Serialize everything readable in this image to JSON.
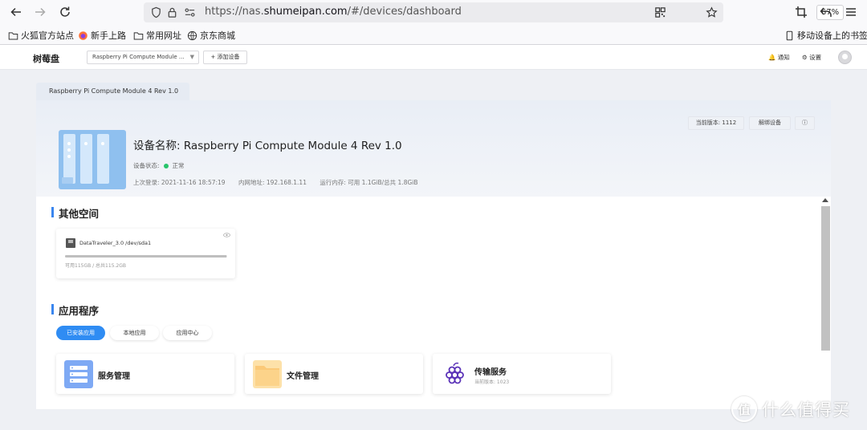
{
  "browser": {
    "url_prefix": "https://nas.",
    "url_domain": "shumeipan.com",
    "url_path": "/#/devices/dashboard",
    "zoom": "67%",
    "bookmarks": [
      "火狐官方站点",
      "新手上路",
      "常用网址",
      "京东商城"
    ],
    "mobile_bookmarks": "移动设备上的书签"
  },
  "header": {
    "brand": "树莓盘",
    "device_select": "Raspberry Pi Compute Module ...",
    "add_device": "+ 添加设备",
    "notify": "通知",
    "settings": "设置"
  },
  "tab": {
    "label": "Raspberry Pi Compute Module 4 Rev 1.0"
  },
  "device": {
    "title": "设备名称: Raspberry Pi Compute Module 4 Rev 1.0",
    "status_label": "设备状态:",
    "status_value": "正常",
    "status_color": "#27c46b",
    "last_login": "上次登录: 2021-11-16 18:57:19",
    "lan_ip": "内网地址: 192.168.1.11",
    "memory": "运行内存: 可用 1.1GiB/总共 1.8GiB",
    "version_btn": "当前版本: 1112",
    "unbind_btn": "解绑设备"
  },
  "other_space": {
    "title": "其他空间",
    "storage": {
      "name": "DataTraveler_3.0 /dev/sda1",
      "capacity": "可用115GB / 总共115.2GB",
      "used_fraction": 0.995
    }
  },
  "apps": {
    "title": "应用程序",
    "tabs": [
      "已安装应用",
      "本地应用",
      "应用中心"
    ],
    "active_tab": 0,
    "items": [
      {
        "name": "服务管理",
        "icon": "server-icon",
        "color": "#7ea9f4"
      },
      {
        "name": "文件管理",
        "icon": "folder-icon",
        "color": "#fbc978"
      },
      {
        "name": "传输服务",
        "sub": "当前版本: 1023",
        "icon": "grape-icon",
        "color": "#5b33b8"
      }
    ]
  },
  "colors": {
    "accent": "#2f8cf3",
    "section_bar": "#3a86ef"
  },
  "watermark": {
    "text": "什么值得买",
    "logo": "值"
  }
}
